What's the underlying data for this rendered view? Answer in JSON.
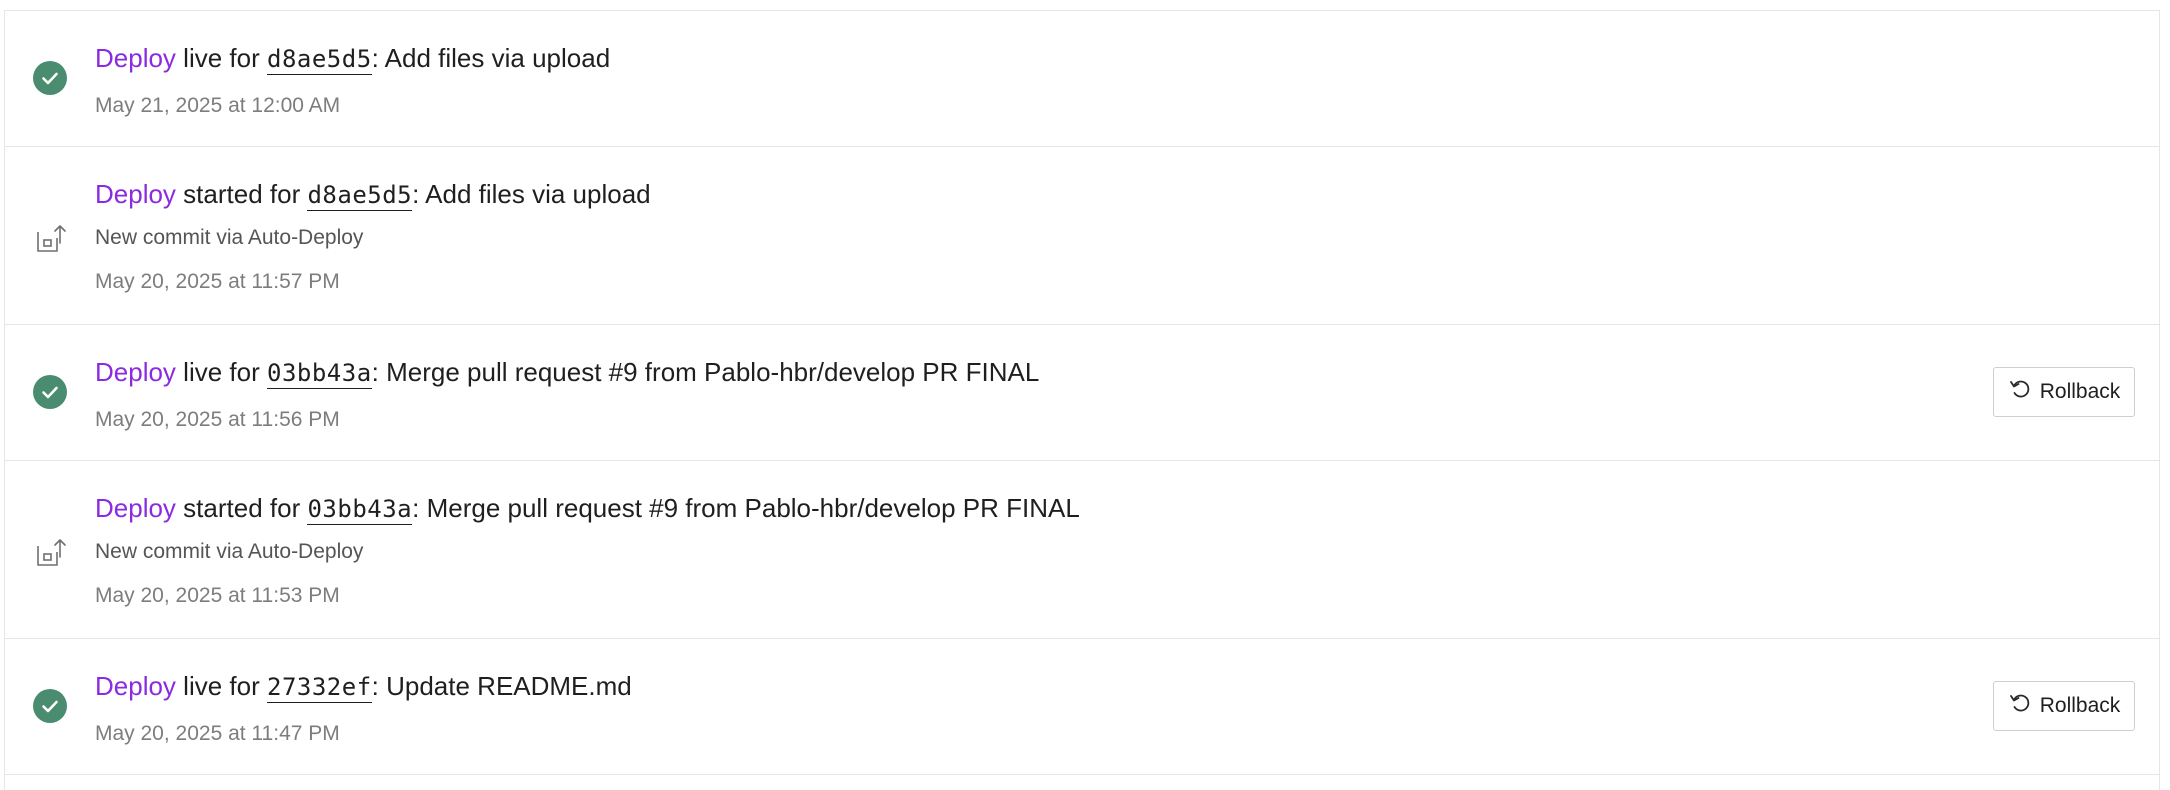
{
  "colors": {
    "accent": "#8a2be2",
    "success": "#4a8c6f",
    "text": "#1f1f1f",
    "muted": "#7d7d7d",
    "border": "#e6e6e6"
  },
  "events": [
    {
      "type": "live",
      "icon": "check-circle-icon",
      "deploy": "Deploy",
      "status": "live",
      "for": "for",
      "commit": "d8ae5d5",
      "message": ": Add files via upload",
      "subtitle": "",
      "timestamp": "May 21, 2025 at 12:00 AM",
      "rollback": ""
    },
    {
      "type": "started",
      "icon": "deploy-upload-icon",
      "deploy": "Deploy",
      "status": "started",
      "for": "for",
      "commit": "d8ae5d5",
      "message": ": Add files via upload",
      "subtitle": "New commit via Auto-Deploy",
      "timestamp": "May 20, 2025 at 11:57 PM",
      "rollback": ""
    },
    {
      "type": "live",
      "icon": "check-circle-icon",
      "deploy": "Deploy",
      "status": "live",
      "for": "for",
      "commit": "03bb43a",
      "message": ": Merge pull request #9 from Pablo-hbr/develop PR FINAL",
      "subtitle": "",
      "timestamp": "May 20, 2025 at 11:56 PM",
      "rollback": "Rollback"
    },
    {
      "type": "started",
      "icon": "deploy-upload-icon",
      "deploy": "Deploy",
      "status": "started",
      "for": "for",
      "commit": "03bb43a",
      "message": ": Merge pull request #9 from Pablo-hbr/develop PR FINAL",
      "subtitle": "New commit via Auto-Deploy",
      "timestamp": "May 20, 2025 at 11:53 PM",
      "rollback": ""
    },
    {
      "type": "live",
      "icon": "check-circle-icon",
      "deploy": "Deploy",
      "status": "live",
      "for": "for",
      "commit": "27332ef",
      "message": ": Update README.md",
      "subtitle": "",
      "timestamp": "May 20, 2025 at 11:47 PM",
      "rollback": "Rollback"
    }
  ]
}
